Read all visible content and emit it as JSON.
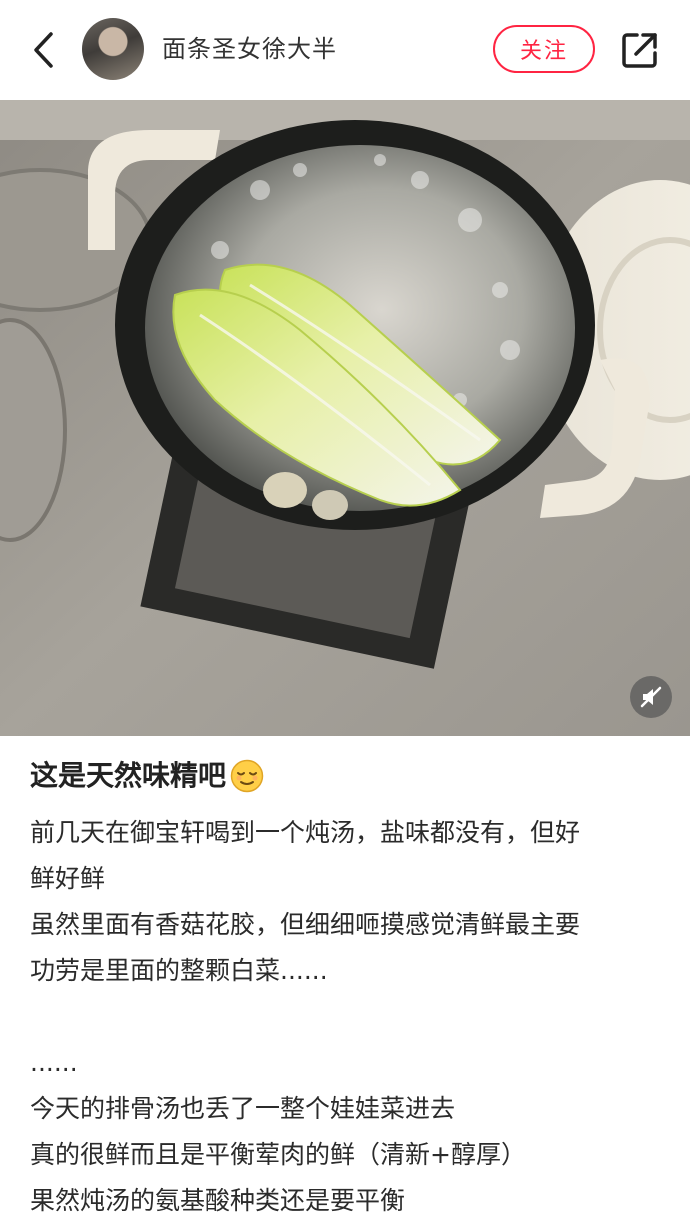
{
  "header": {
    "back_icon": "chevron-left-icon",
    "author_name": "面条圣女徐大半",
    "follow_label": "关注",
    "share_icon": "share-icon",
    "accent_color": "#ff2442"
  },
  "media": {
    "description_icon": "mute-icon"
  },
  "post": {
    "title": "这是天然味精吧",
    "title_emoji": "relieved-face-emoji",
    "lines": [
      "前几天在御宝轩喝到一个炖汤，盐味都没有，但好",
      "鲜好鲜",
      "虽然里面有香菇花胶，但细细咂摸感觉清鲜最主要",
      "功劳是里面的整颗白菜......",
      "",
      "......",
      "今天的排骨汤也丢了一整个娃娃菜进去",
      "真的很鲜而且是平衡荤肉的鲜（清新+醇厚）",
      "果然炖汤的氨基酸种类还是要平衡"
    ]
  }
}
